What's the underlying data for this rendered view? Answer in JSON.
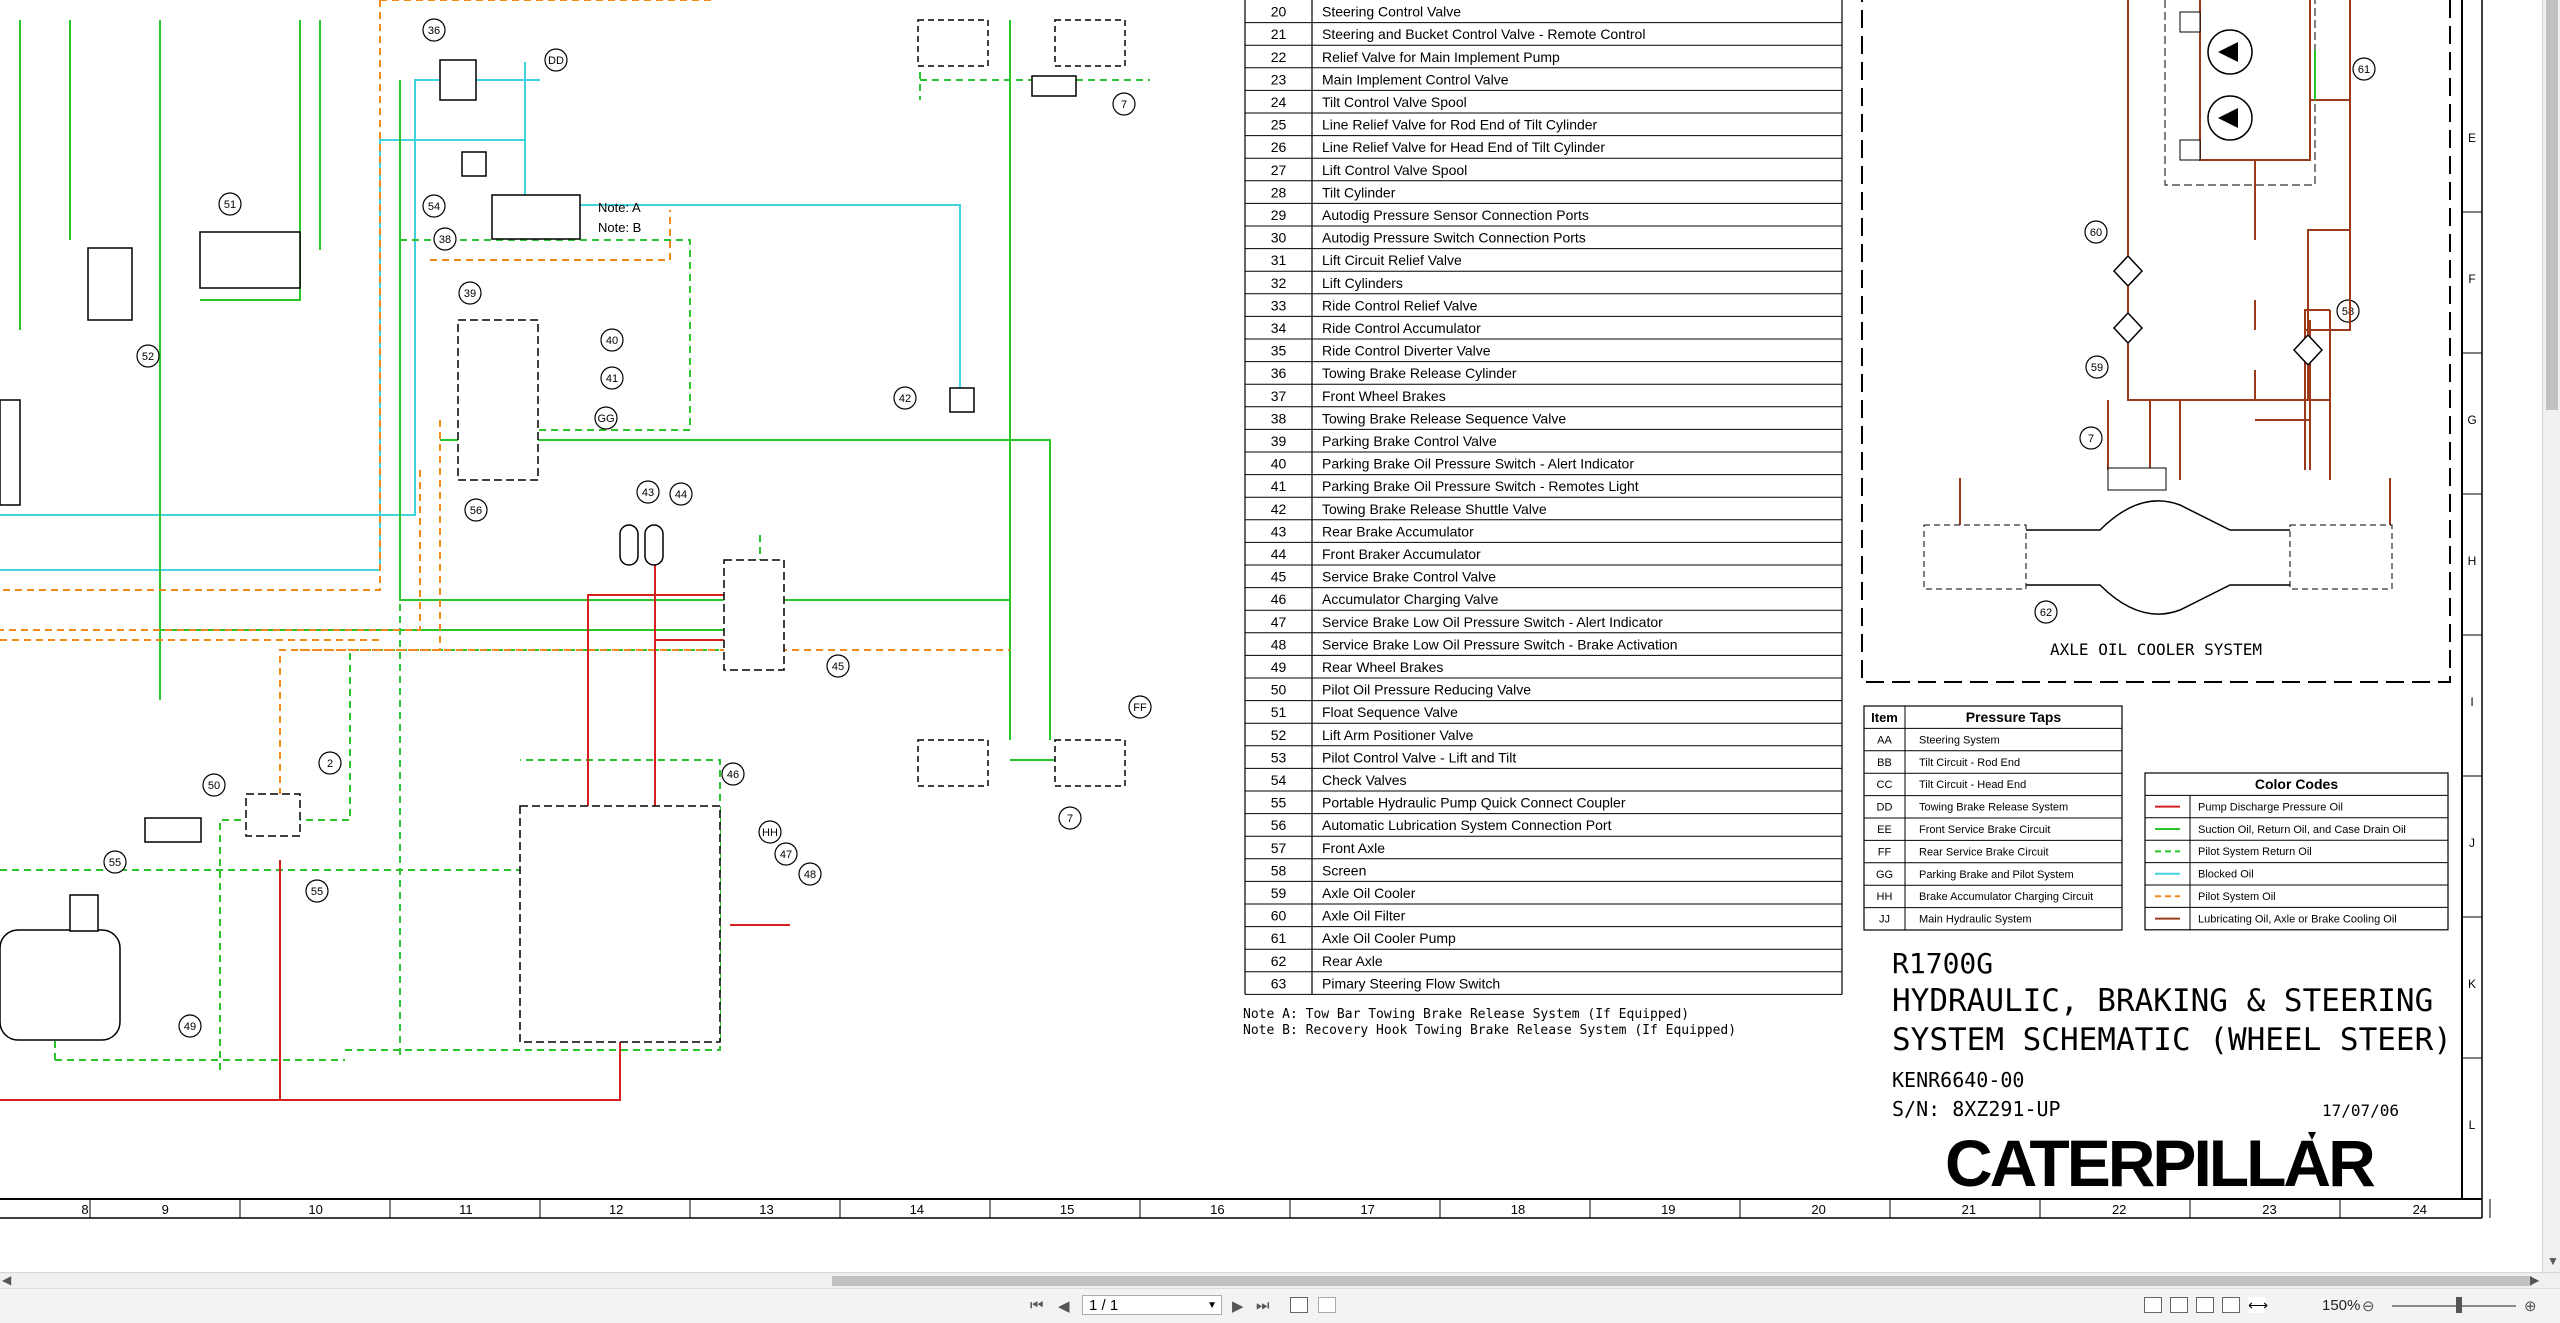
{
  "components_table": [
    {
      "num": "20",
      "desc": "Steering Control Valve"
    },
    {
      "num": "21",
      "desc": "Steering and Bucket Control Valve - Remote Control"
    },
    {
      "num": "22",
      "desc": "Relief Valve for Main Implement Pump"
    },
    {
      "num": "23",
      "desc": "Main Implement Control Valve"
    },
    {
      "num": "24",
      "desc": "Tilt Control Valve Spool"
    },
    {
      "num": "25",
      "desc": "Line Relief Valve for Rod End of Tilt Cylinder"
    },
    {
      "num": "26",
      "desc": "Line Relief Valve for Head End of Tilt Cylinder"
    },
    {
      "num": "27",
      "desc": "Lift Control Valve Spool"
    },
    {
      "num": "28",
      "desc": "Tilt Cylinder"
    },
    {
      "num": "29",
      "desc": "Autodig Pressure Sensor Connection Ports"
    },
    {
      "num": "30",
      "desc": "Autodig Pressure Switch Connection Ports"
    },
    {
      "num": "31",
      "desc": "Lift Circuit Relief Valve"
    },
    {
      "num": "32",
      "desc": "Lift Cylinders"
    },
    {
      "num": "33",
      "desc": "Ride Control Relief Valve"
    },
    {
      "num": "34",
      "desc": "Ride Control Accumulator"
    },
    {
      "num": "35",
      "desc": "Ride Control Diverter Valve"
    },
    {
      "num": "36",
      "desc": "Towing Brake Release Cylinder"
    },
    {
      "num": "37",
      "desc": "Front Wheel Brakes"
    },
    {
      "num": "38",
      "desc": "Towing Brake Release Sequence Valve"
    },
    {
      "num": "39",
      "desc": "Parking Brake Control Valve"
    },
    {
      "num": "40",
      "desc": "Parking Brake Oil Pressure Switch - Alert Indicator"
    },
    {
      "num": "41",
      "desc": "Parking Brake Oil Pressure Switch - Remotes Light"
    },
    {
      "num": "42",
      "desc": "Towing Brake Release Shuttle Valve"
    },
    {
      "num": "43",
      "desc": "Rear Brake Accumulator"
    },
    {
      "num": "44",
      "desc": "Front Braker Accumulator"
    },
    {
      "num": "45",
      "desc": "Service Brake Control Valve"
    },
    {
      "num": "46",
      "desc": "Accumulator Charging Valve"
    },
    {
      "num": "47",
      "desc": "Service Brake Low Oil Pressure Switch - Alert Indicator"
    },
    {
      "num": "48",
      "desc": "Service Brake Low Oil Pressure Switch - Brake Activation"
    },
    {
      "num": "49",
      "desc": "Rear Wheel Brakes"
    },
    {
      "num": "50",
      "desc": "Pilot Oil Pressure Reducing Valve"
    },
    {
      "num": "51",
      "desc": "Float Sequence Valve"
    },
    {
      "num": "52",
      "desc": "Lift Arm Positioner Valve"
    },
    {
      "num": "53",
      "desc": "Pilot Control Valve - Lift and Tilt"
    },
    {
      "num": "54",
      "desc": "Check Valves"
    },
    {
      "num": "55",
      "desc": "Portable Hydraulic Pump Quick Connect Coupler"
    },
    {
      "num": "56",
      "desc": "Automatic Lubrication System Connection Port"
    },
    {
      "num": "57",
      "desc": "Front Axle"
    },
    {
      "num": "58",
      "desc": "Screen"
    },
    {
      "num": "59",
      "desc": "Axle Oil Cooler"
    },
    {
      "num": "60",
      "desc": "Axle Oil Filter"
    },
    {
      "num": "61",
      "desc": "Axle Oil Cooler Pump"
    },
    {
      "num": "62",
      "desc": "Rear Axle"
    },
    {
      "num": "63",
      "desc": "Pimary Steering Flow Switch"
    }
  ],
  "notes": {
    "a": "Note A: Tow Bar Towing Brake Release System (If Equipped)",
    "b": "Note B: Recovery Hook Towing Brake Release System (If Equipped)"
  },
  "pressure_taps": {
    "header_item": "Item",
    "header_title": "Pressure Taps",
    "rows": [
      {
        "item": "AA",
        "desc": "Steering System"
      },
      {
        "item": "BB",
        "desc": "Tilt Circuit - Rod End"
      },
      {
        "item": "CC",
        "desc": "Tilt Circuit - Head End"
      },
      {
        "item": "DD",
        "desc": "Towing Brake Release System"
      },
      {
        "item": "EE",
        "desc": "Front Service Brake Circuit"
      },
      {
        "item": "FF",
        "desc": "Rear Service Brake Circuit"
      },
      {
        "item": "GG",
        "desc": "Parking Brake and Pilot System"
      },
      {
        "item": "HH",
        "desc": "Brake Accumulator Charging Circuit"
      },
      {
        "item": "JJ",
        "desc": "Main Hydraulic System"
      }
    ]
  },
  "color_codes": {
    "title": "Color Codes",
    "rows": [
      {
        "color": "#d62020",
        "dash": "",
        "desc": "Pump Discharge Pressure Oil"
      },
      {
        "color": "#2bc42b",
        "dash": "",
        "desc": "Suction Oil, Return Oil, and Case Drain Oil"
      },
      {
        "color": "#2bc42b",
        "dash": "6,4",
        "desc": "Pilot System Return Oil"
      },
      {
        "color": "#3fd3e0",
        "dash": "",
        "desc": "Blocked Oil"
      },
      {
        "color": "#f08a1c",
        "dash": "6,4",
        "desc": "Pilot System Oil"
      },
      {
        "color": "#9a3a1a",
        "dash": "",
        "desc": "Lubricating Oil, Axle or Brake Cooling Oil"
      }
    ]
  },
  "axle_cooler_title": "AXLE OIL COOLER SYSTEM",
  "title_block": {
    "model": "R1700G",
    "line1": "HYDRAULIC, BRAKING & STEERING",
    "line2": "SYSTEM SCHEMATIC (WHEEL STEER)",
    "doc_number": "KENR6640-00",
    "serial": "S/N: 8XZ291-UP",
    "date": "17/07/06",
    "brand": "CATERPILLAR"
  },
  "grid_columns": [
    "8",
    "9",
    "10",
    "11",
    "12",
    "13",
    "14",
    "15",
    "16",
    "17",
    "18",
    "19",
    "20",
    "21",
    "22",
    "23",
    "24"
  ],
  "grid_rows": [
    "E",
    "F",
    "G",
    "H",
    "I",
    "J",
    "K",
    "L"
  ],
  "callouts": [
    "36",
    "DD",
    "51",
    "54",
    "38",
    "52",
    "39",
    "40",
    "41",
    "GG",
    "42",
    "56",
    "43",
    "44",
    "45",
    "46",
    "HH",
    "47",
    "48",
    "7",
    "50",
    "2",
    "55",
    "55",
    "49",
    "FF",
    "7",
    "61",
    "60",
    "58",
    "59",
    "7",
    "62"
  ],
  "valve_notes": [
    "Note: A",
    "Note: B"
  ],
  "statusbar": {
    "page": "1 / 1",
    "zoom": "150%"
  }
}
